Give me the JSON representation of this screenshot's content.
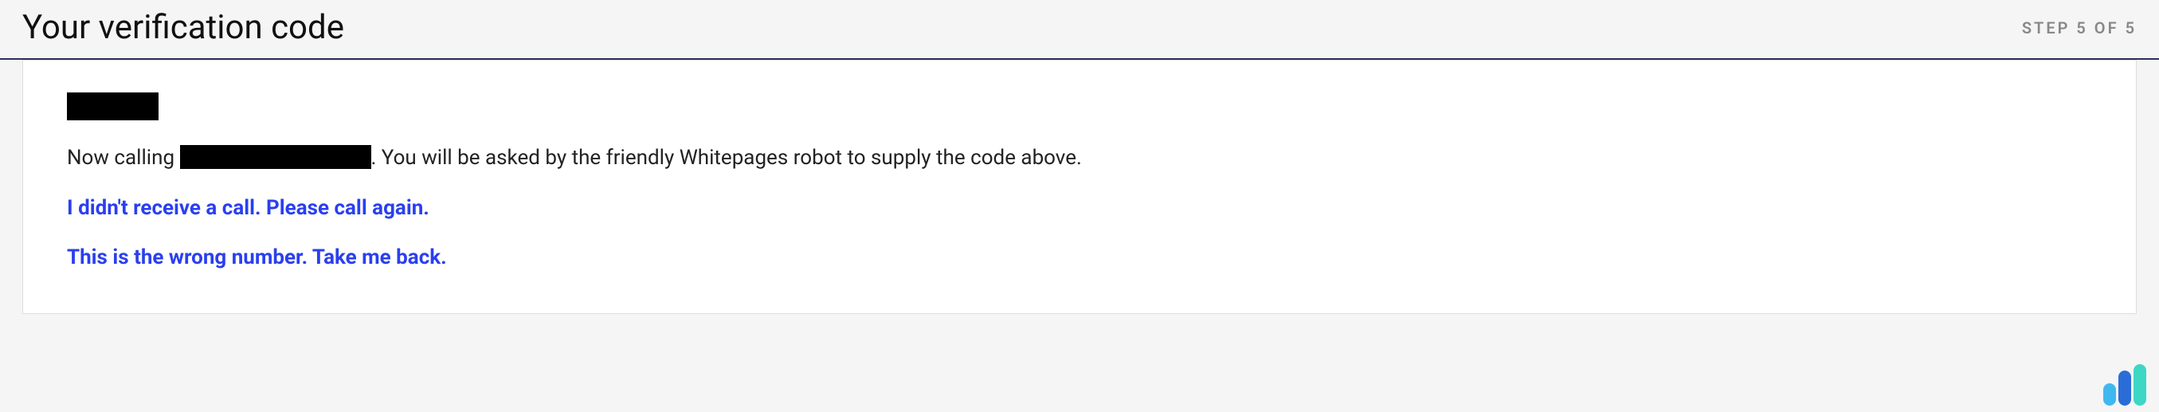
{
  "header": {
    "title": "Your verification code",
    "step_indicator": "STEP 5 OF 5"
  },
  "card": {
    "calling_prefix": "Now calling ",
    "calling_suffix": ". You will be asked by the friendly Whitepages robot to supply the code above.",
    "link_no_call": "I didn't receive a call. Please call again.",
    "link_wrong_number": "This is the wrong number. Take me back."
  }
}
